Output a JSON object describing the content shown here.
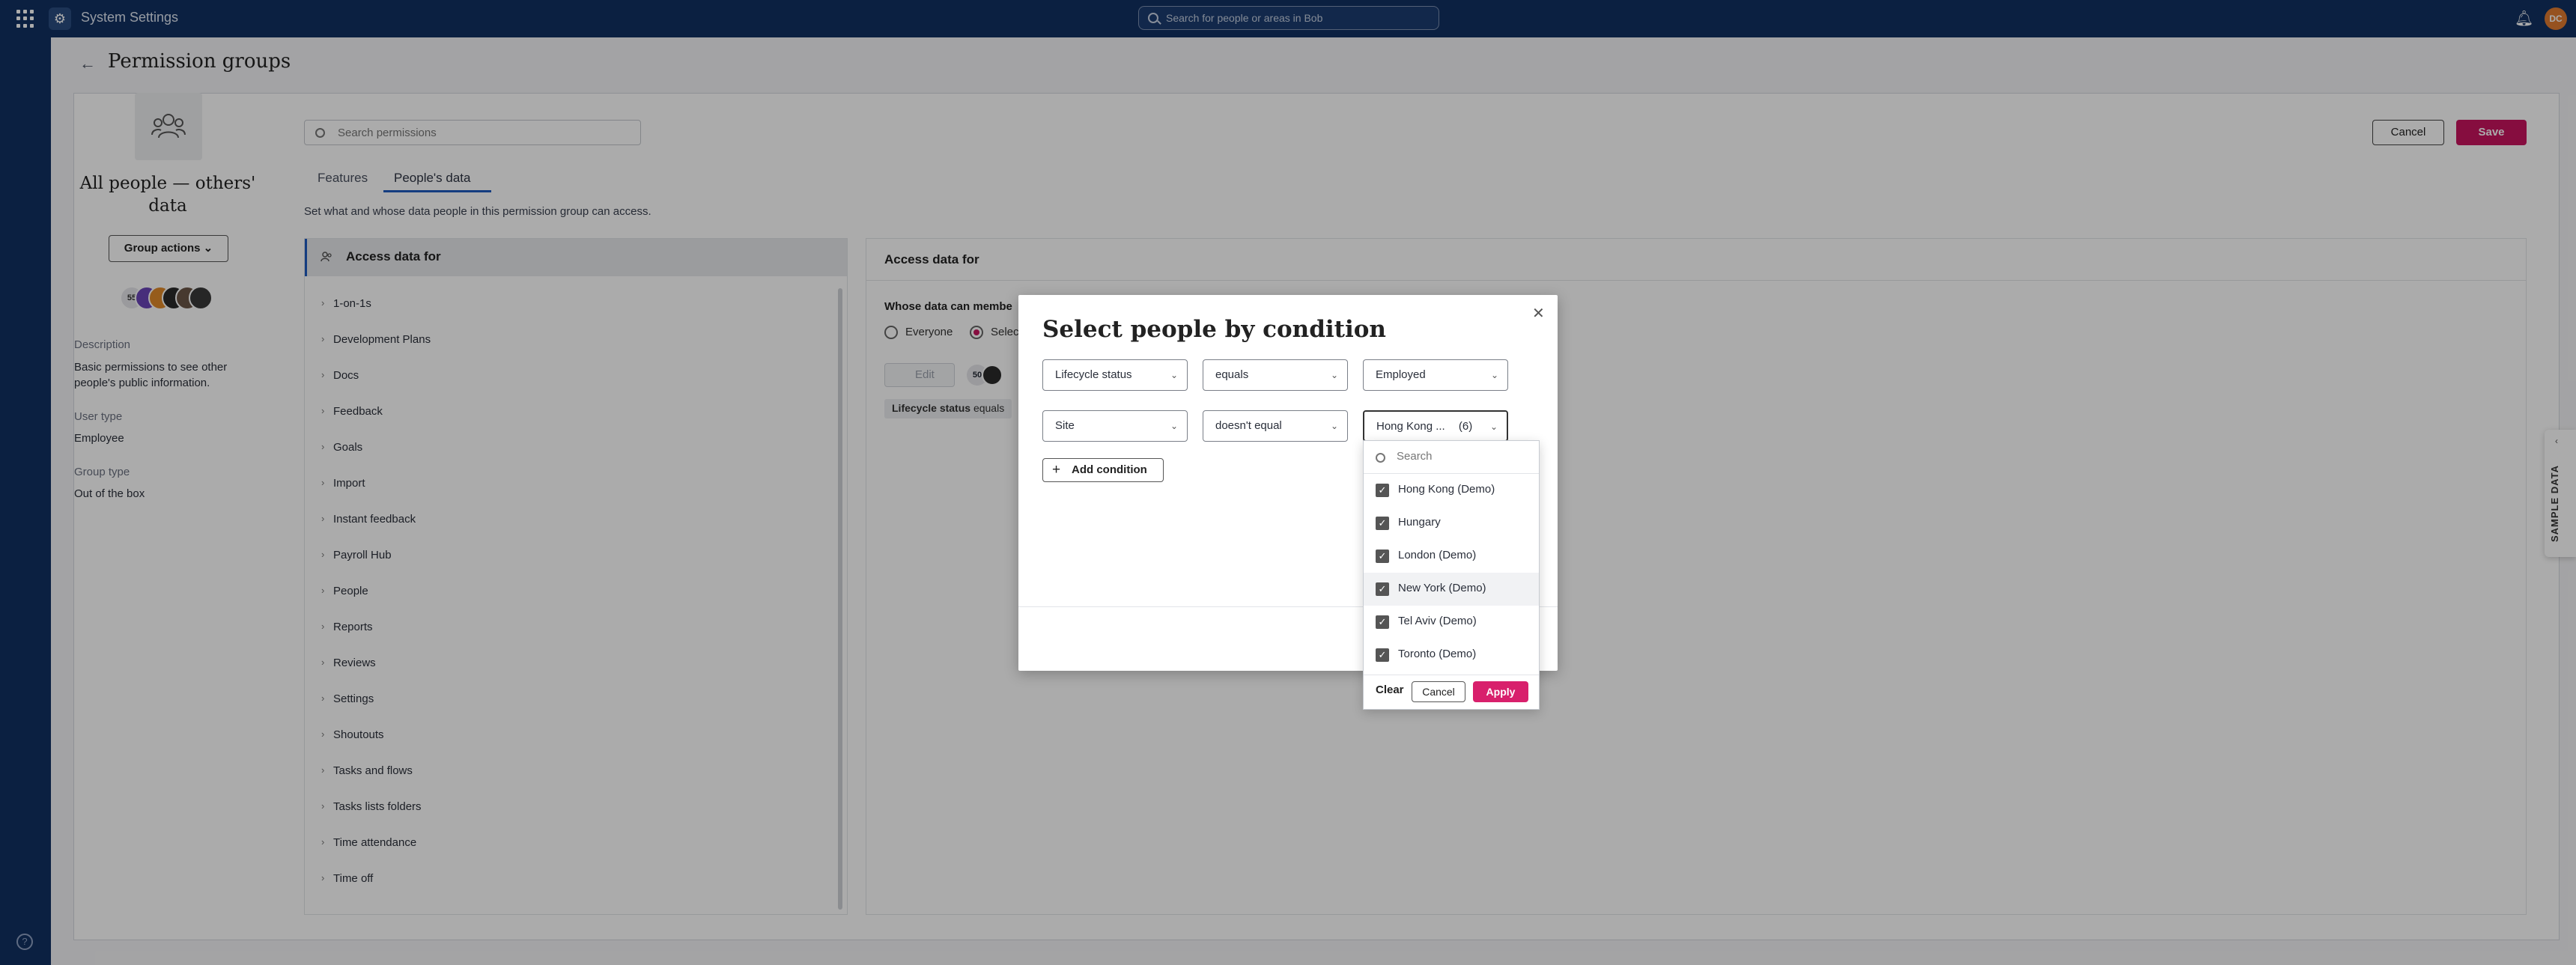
{
  "topbar": {
    "app_title": "System Settings",
    "search_placeholder": "Search for people or areas in Bob",
    "avatar_initials": "DC"
  },
  "page": {
    "title": "Permission groups"
  },
  "group": {
    "name": "All people — others' data",
    "actions_label": "Group actions",
    "member_count": "55",
    "description_label": "Description",
    "description_value": "Basic permissions to see other people's public information.",
    "user_type_label": "User type",
    "user_type_value": "Employee",
    "group_type_label": "Group type",
    "group_type_value": "Out of the box"
  },
  "toolbar": {
    "search_placeholder": "Search permissions",
    "cancel_label": "Cancel",
    "save_label": "Save"
  },
  "tabs": [
    {
      "label": "Features"
    },
    {
      "label": "People's data"
    }
  ],
  "tab_description": "Set what and whose data people in this permission group can access.",
  "left_panel": {
    "header": "Access data for",
    "items": [
      "1-on-1s",
      "Development Plans",
      "Docs",
      "Feedback",
      "Goals",
      "Import",
      "Instant feedback",
      "Payroll Hub",
      "People",
      "Reports",
      "Reviews",
      "Settings",
      "Shoutouts",
      "Tasks and flows",
      "Tasks lists folders",
      "Time attendance",
      "Time off"
    ]
  },
  "right_panel": {
    "header": "Access data for",
    "question": "Whose data can membe",
    "option_everyone": "Everyone",
    "option_select": "Selec",
    "edit_label": "Edit",
    "member_count": "50",
    "chip_key": "Lifecycle status",
    "chip_rest": "equals"
  },
  "modal": {
    "title": "Select people by condition",
    "conditions": [
      {
        "field": "Lifecycle status",
        "operator": "equals",
        "value": "Employed"
      },
      {
        "field": "Site",
        "operator": "doesn't equal",
        "value": "Hong Kong ...",
        "count": "(6)"
      }
    ],
    "add_condition_label": "Add condition"
  },
  "dropdown": {
    "search_placeholder": "Search",
    "options": [
      {
        "label": "Hong Kong (Demo)",
        "checked": true
      },
      {
        "label": "Hungary",
        "checked": true
      },
      {
        "label": "London (Demo)",
        "checked": true
      },
      {
        "label": "New York (Demo)",
        "checked": true
      },
      {
        "label": "Tel Aviv (Demo)",
        "checked": true
      },
      {
        "label": "Toronto (Demo)",
        "checked": true
      }
    ],
    "clear_label": "Clear",
    "cancel_label": "Cancel",
    "apply_label": "Apply"
  },
  "sample_tab": {
    "label": "SAMPLE DATA"
  },
  "colors": {
    "topbar": "#113162",
    "accent": "#c8145e",
    "tab_active": "#1f5cbf"
  }
}
